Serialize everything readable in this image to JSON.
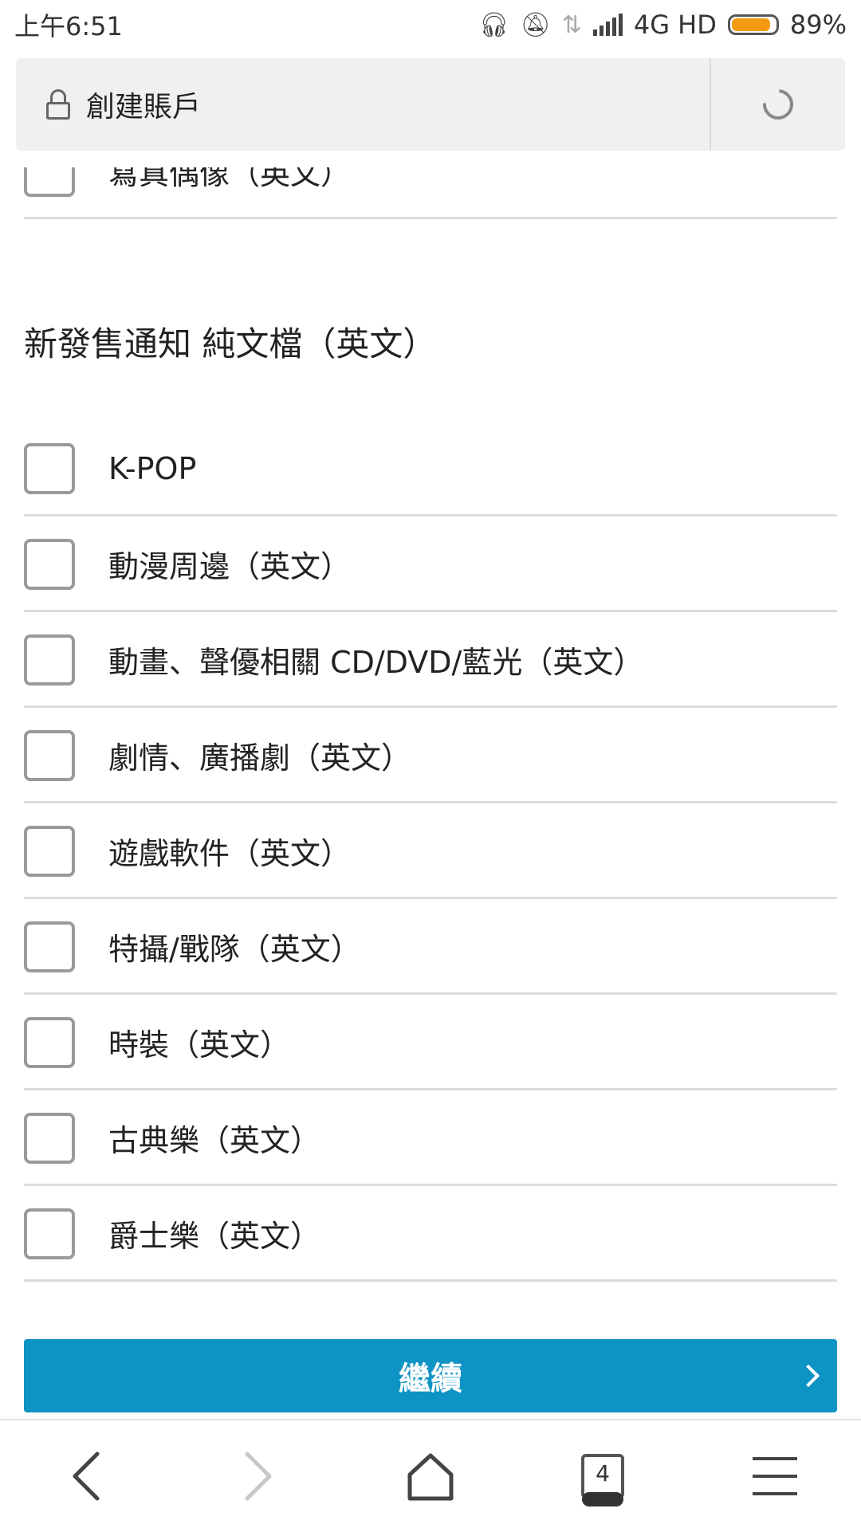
{
  "status_bar": {
    "time": "上午6:51",
    "network": "4G HD",
    "battery": "89%",
    "battery_level": 0.89
  },
  "url_bar": {
    "title": "創建賬戶"
  },
  "partial_row": {
    "label": "寫真偶像（英文）"
  },
  "section": {
    "title": "新發售通知 純文檔（英文）"
  },
  "options": [
    {
      "label": "K-POP",
      "checked": false
    },
    {
      "label": "動漫周邊（英文）",
      "checked": false
    },
    {
      "label": "動畫、聲優相關 CD/DVD/藍光（英文）",
      "checked": false
    },
    {
      "label": "劇情、廣播劇（英文）",
      "checked": false
    },
    {
      "label": "遊戲軟件（英文）",
      "checked": false
    },
    {
      "label": "特攝/戰隊（英文）",
      "checked": false
    },
    {
      "label": "時裝（英文）",
      "checked": false
    },
    {
      "label": "古典樂（英文）",
      "checked": false
    },
    {
      "label": "爵士樂（英文）",
      "checked": false
    }
  ],
  "continue_button": {
    "label": "繼續"
  },
  "bottom_nav": {
    "tab_count": "4"
  },
  "colors": {
    "accent": "#0d93c4",
    "battery": "#f39a12"
  }
}
